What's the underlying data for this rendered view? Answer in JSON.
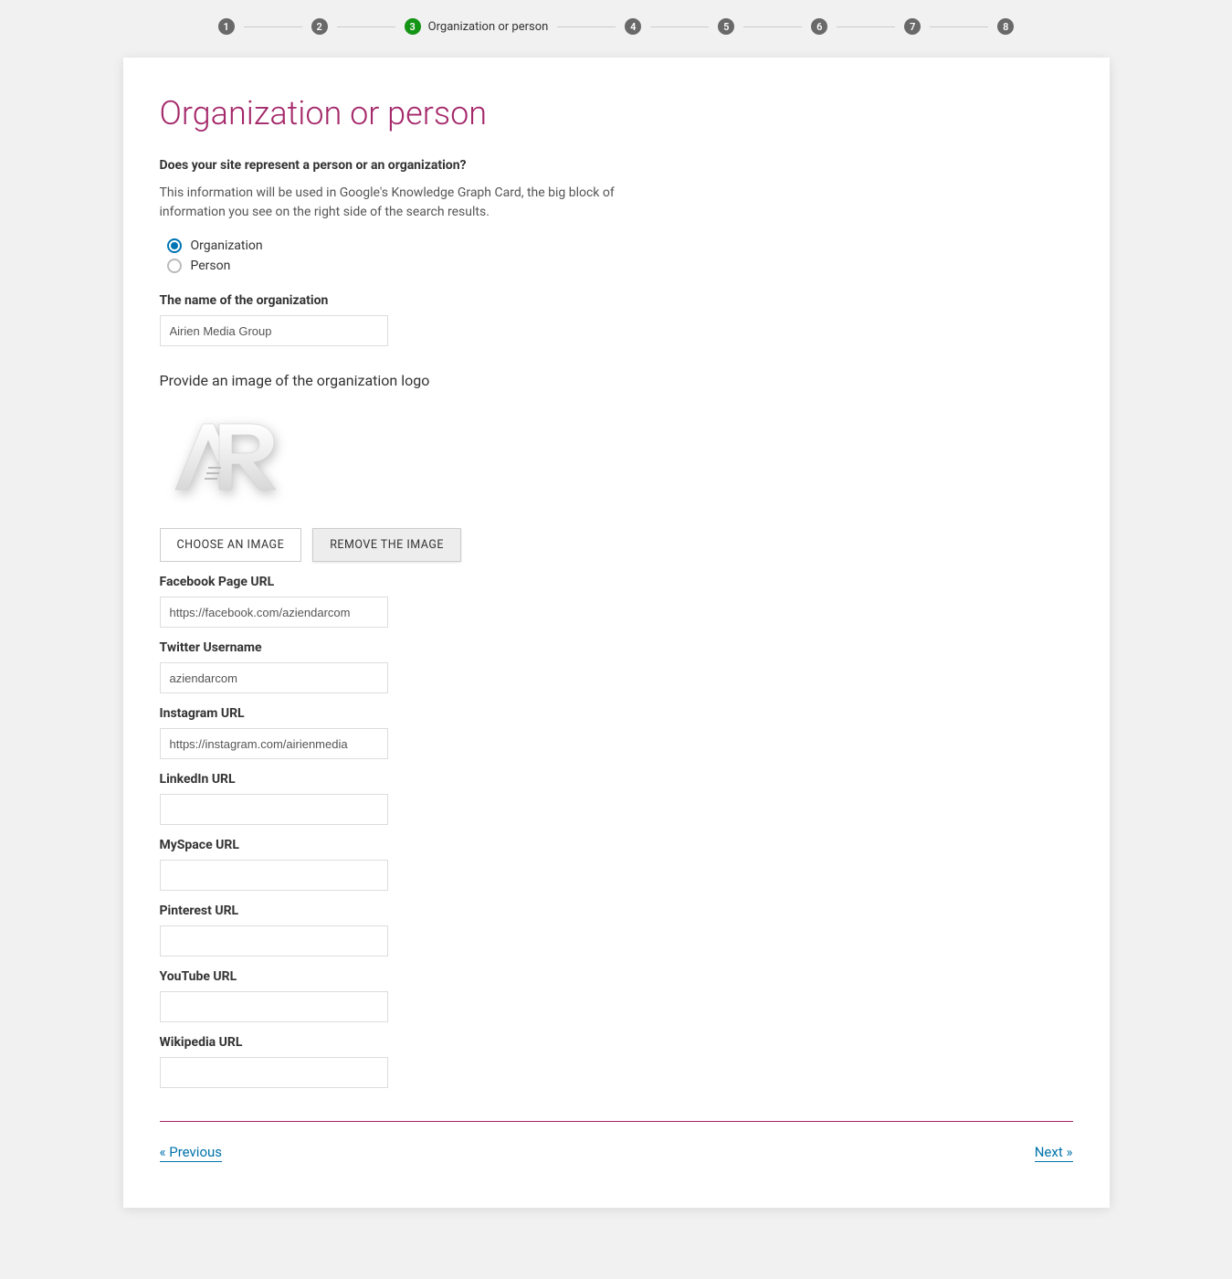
{
  "stepper": {
    "steps": [
      {
        "num": "1",
        "label": "",
        "active": false
      },
      {
        "num": "2",
        "label": "",
        "active": false
      },
      {
        "num": "3",
        "label": "Organization or person",
        "active": true
      },
      {
        "num": "4",
        "label": "",
        "active": false
      },
      {
        "num": "5",
        "label": "",
        "active": false
      },
      {
        "num": "6",
        "label": "",
        "active": false
      },
      {
        "num": "7",
        "label": "",
        "active": false
      },
      {
        "num": "8",
        "label": "",
        "active": false
      }
    ]
  },
  "title": "Organization or person",
  "question": "Does your site represent a person or an organization?",
  "helper": "This information will be used in Google's Knowledge Graph Card, the big block of information you see on the right side of the search results.",
  "radios": {
    "organization": "Organization",
    "person": "Person",
    "selected": "organization"
  },
  "org_name": {
    "label": "The name of the organization",
    "value": "Airien Media Group"
  },
  "logo": {
    "instruction": "Provide an image of the organization logo",
    "choose_btn": "CHOOSE AN IMAGE",
    "remove_btn": "REMOVE THE IMAGE"
  },
  "socials": [
    {
      "key": "facebook",
      "label": "Facebook Page URL",
      "value": "https://facebook.com/aziendarcom"
    },
    {
      "key": "twitter",
      "label": "Twitter Username",
      "value": "aziendarcom"
    },
    {
      "key": "instagram",
      "label": "Instagram URL",
      "value": "https://instagram.com/airienmedia"
    },
    {
      "key": "linkedin",
      "label": "LinkedIn URL",
      "value": ""
    },
    {
      "key": "myspace",
      "label": "MySpace URL",
      "value": ""
    },
    {
      "key": "pinterest",
      "label": "Pinterest URL",
      "value": ""
    },
    {
      "key": "youtube",
      "label": "YouTube URL",
      "value": ""
    },
    {
      "key": "wikipedia",
      "label": "Wikipedia URL",
      "value": ""
    }
  ],
  "nav": {
    "prev": "« Previous",
    "next": "Next »"
  }
}
